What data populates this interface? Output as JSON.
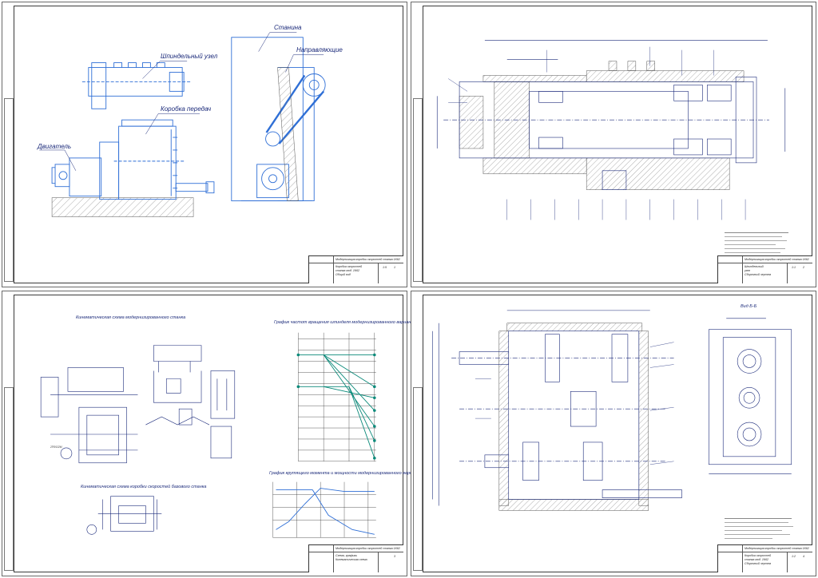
{
  "colors": {
    "line": "#1b2a7a",
    "blue": "#2f6fd6",
    "hatch": "#7a7a7a"
  },
  "sheets": {
    "general_view": {
      "labels": {
        "spindle": "Шпиндельный узел",
        "gearbox": "Коробка передач",
        "motor": "Двигатель",
        "bed": "Станина",
        "guides": "Направляющие"
      },
      "title_block": {
        "doc": "Модернизация коробки скоростей станка 1К62",
        "name1": "Коробка скоростей",
        "name2": "станка мод. 1К62",
        "name3": "Общий вид",
        "scale": "1:5",
        "sheet": "1"
      }
    },
    "spindle_unit": {
      "title_block": {
        "doc": "Модернизация коробки скоростей станка 1К62",
        "name1": "Шпиндельный",
        "name2": "узел",
        "name3": "Сборочный чертеж",
        "scale": "1:1",
        "sheet": "2"
      }
    },
    "kinematics": {
      "title_top": "Кинематическая схема модернизированного станка",
      "title_bottom": "Кинематическая схема коробки скоростей базового станка",
      "graph_speeds_title": "График частот вращения шпинделя модернизированного варианта ПГД",
      "graph_torque_title": "График крутящего момента и мощности модернизированного варианта",
      "motor_label": "2ПФ132М",
      "title_block": {
        "doc": "Модернизация коробки скоростей станка 1К62",
        "name1": "Схема, графики",
        "name2": "Кинематическая схема",
        "name3": "",
        "scale": "",
        "sheet": "3"
      }
    },
    "gearbox_assembly": {
      "section_label": "Вид Б-Б",
      "title_block": {
        "doc": "Модернизация коробки скоростей станка 1К62",
        "name1": "Коробка скоростей",
        "name2": "станка мод. 1К62",
        "name3": "Сборочный чертеж",
        "scale": "1:2",
        "sheet": "4"
      }
    }
  }
}
